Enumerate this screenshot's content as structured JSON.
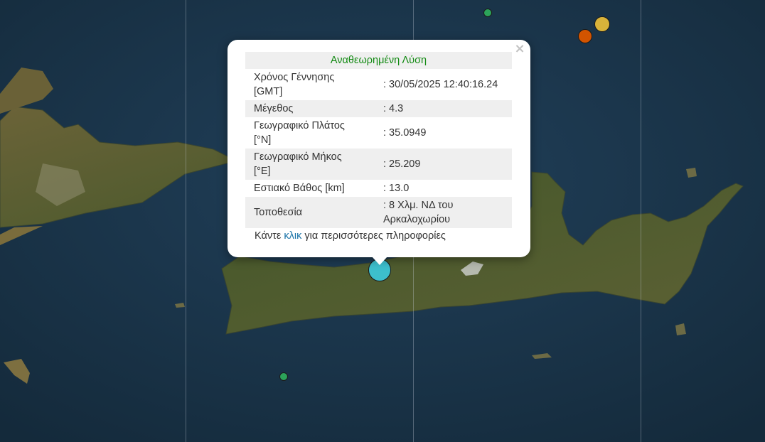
{
  "popup": {
    "title": "Αναθεωρημένη Λύση",
    "close_symbol": "×",
    "rows": [
      {
        "label": "Χρόνος Γέννησης [GMT]",
        "value": ": 30/05/2025 12:40:16.24"
      },
      {
        "label": "Μέγεθος",
        "value": ": 4.3"
      },
      {
        "label": "Γεωγραφικό Πλάτος [°N]",
        "value": ": 35.0949"
      },
      {
        "label": "Γεωγραφικό Μήκος [°E]",
        "value": ": 25.209"
      },
      {
        "label": "Εστιακό Βάθος [km]",
        "value": ": 13.0"
      },
      {
        "label": "Τοποθεσία",
        "value": ": 8 Χλμ. ΝΔ του Αρκαλοχωρίου"
      }
    ],
    "footer": {
      "before": "Κάντε ",
      "link": "κλικ",
      "after": " για περισσότερες πληροφορίες"
    }
  },
  "markers": [
    {
      "id": "selected-quake",
      "color": "#3dbfcc"
    },
    {
      "id": "quake-orange",
      "color": "#d35400"
    },
    {
      "id": "quake-yellow",
      "color": "#d9b33a"
    },
    {
      "id": "quake-green-north",
      "color": "#2ca35a"
    },
    {
      "id": "quake-green-south",
      "color": "#2ca35a"
    }
  ],
  "colors": {
    "sea": "#1b3447",
    "land": "#4f5b2f",
    "popup_title": "#138a13",
    "link": "#1a73a8"
  }
}
